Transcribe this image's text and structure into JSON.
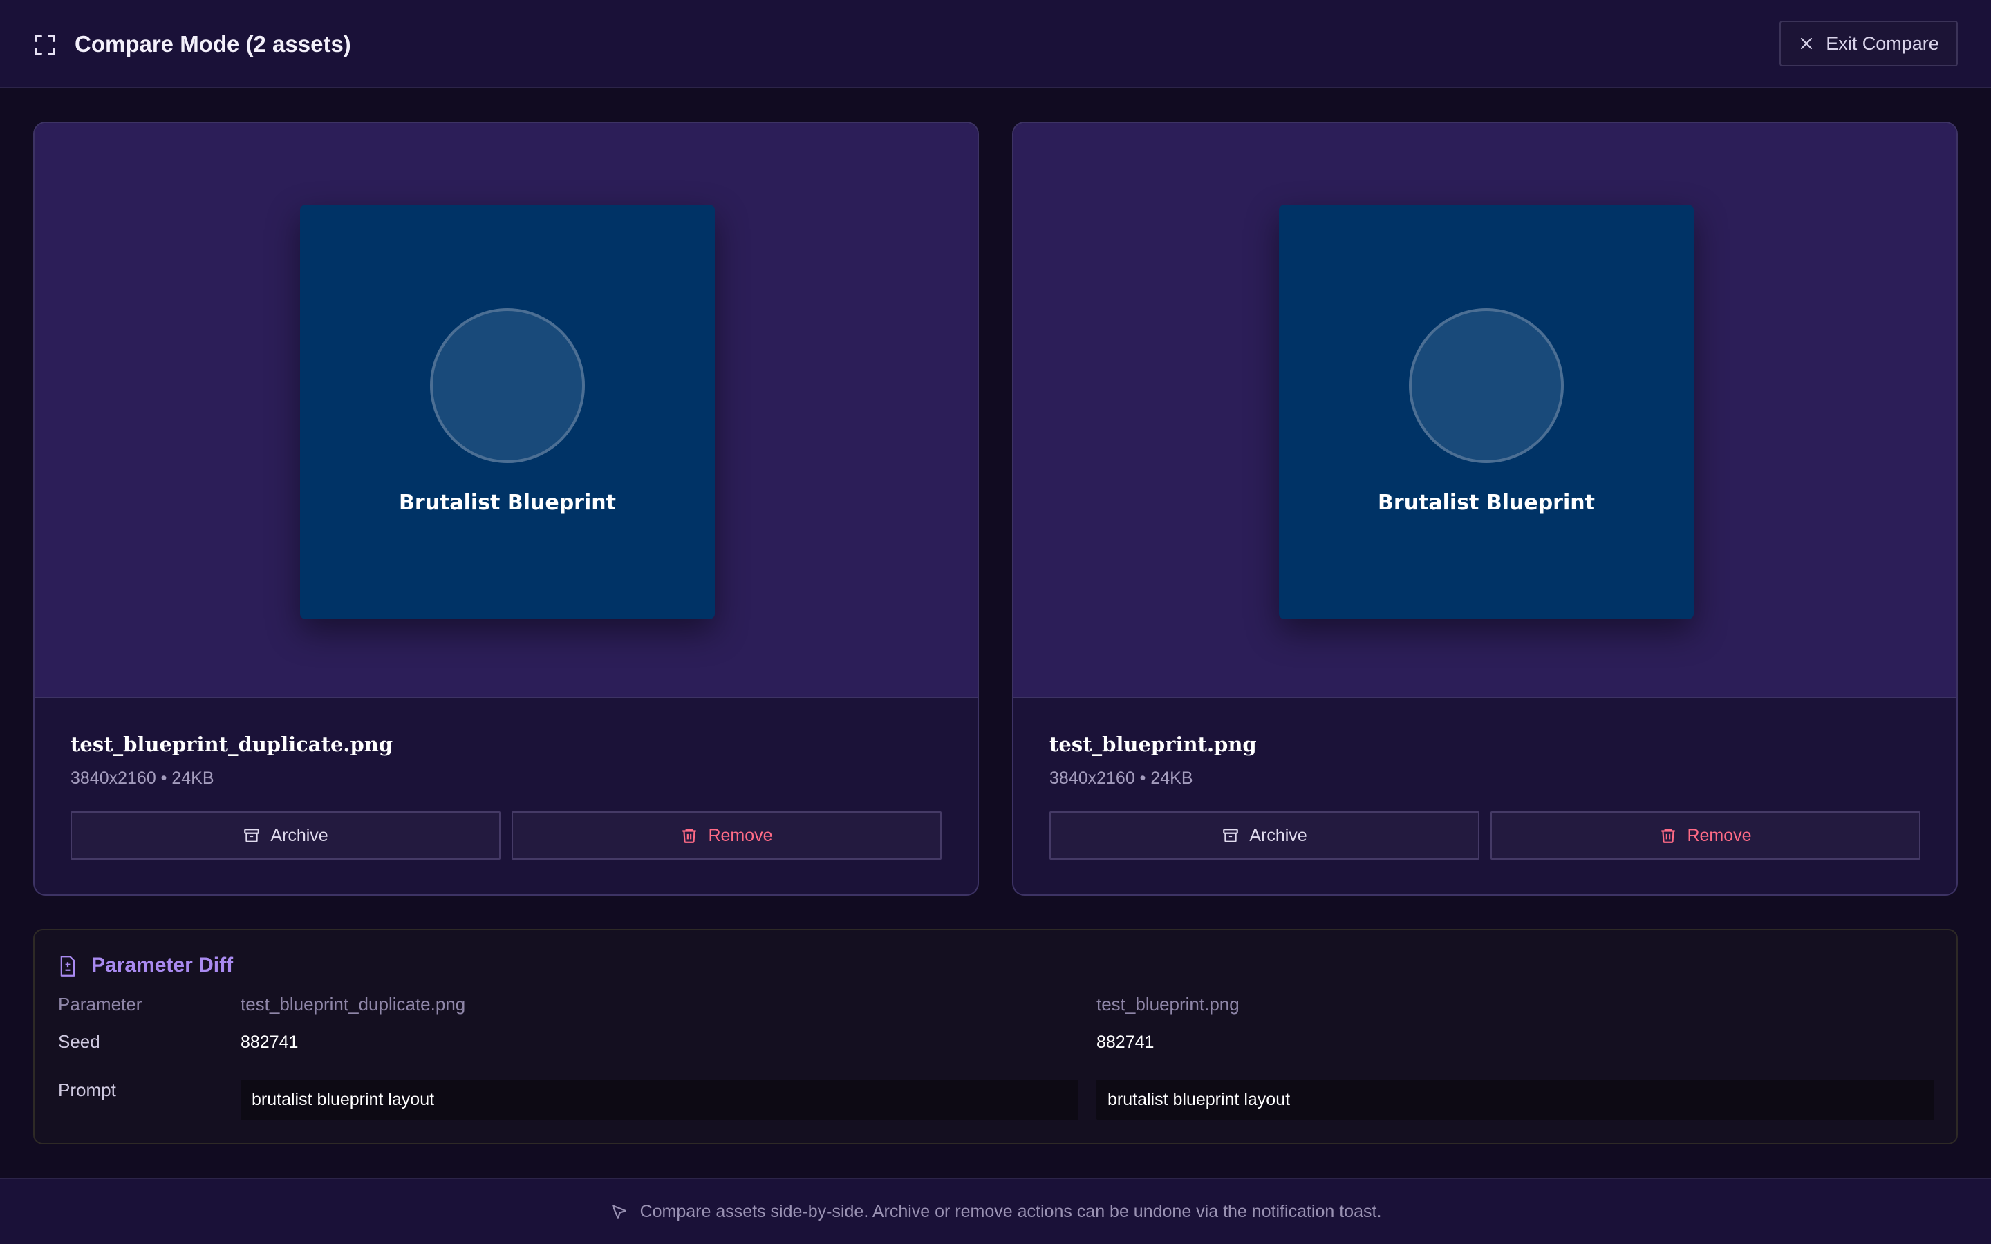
{
  "header": {
    "title": "Compare Mode (2 assets)",
    "exit_label": "Exit Compare"
  },
  "assets": [
    {
      "thumb_label": "Brutalist Blueprint",
      "filename": "test_blueprint_duplicate.png",
      "meta": "3840x2160 • 24KB",
      "archive_label": "Archive",
      "remove_label": "Remove"
    },
    {
      "thumb_label": "Brutalist Blueprint",
      "filename": "test_blueprint.png",
      "meta": "3840x2160 • 24KB",
      "archive_label": "Archive",
      "remove_label": "Remove"
    }
  ],
  "diff": {
    "title": "Parameter Diff",
    "columns": [
      "Parameter",
      "test_blueprint_duplicate.png",
      "test_blueprint.png"
    ],
    "rows": [
      {
        "label": "Seed",
        "values": [
          "882741",
          "882741"
        ]
      },
      {
        "label": "Prompt",
        "values": [
          "brutalist blueprint layout",
          "brutalist blueprint layout"
        ]
      }
    ]
  },
  "footer": {
    "text": "Compare assets side-by-side. Archive or remove actions can be undone via the notification toast."
  },
  "colors": {
    "accent": "#a98af0",
    "danger": "#ff6b86",
    "thumb_bg": "#003366"
  },
  "icons": [
    "expand-icon",
    "close-icon",
    "archive-icon",
    "trash-icon",
    "file-diff-icon",
    "cursor-icon"
  ]
}
